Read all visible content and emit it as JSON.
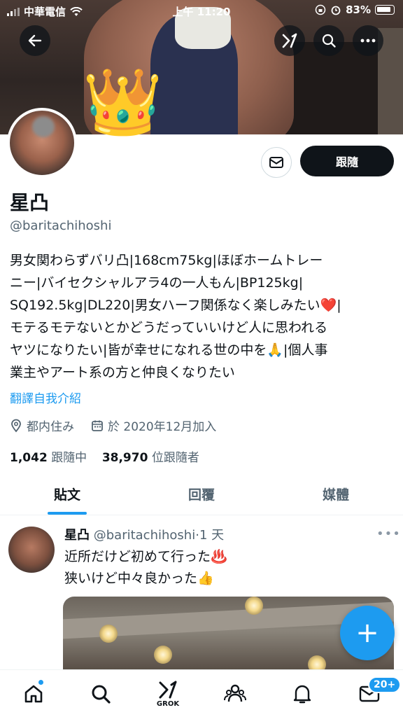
{
  "status_bar": {
    "carrier": "中華電信",
    "time": "上午 11:20",
    "battery": "83%"
  },
  "header": {
    "back_icon": "arrow-left-icon",
    "grok_icon": "grok-icon",
    "search_icon": "search-icon",
    "more_icon": "more-horizontal-icon"
  },
  "profile": {
    "crown": "👑",
    "follow_label": "跟隨",
    "name": "星凸",
    "handle": "@baritachihoshi",
    "bio_lines": [
      "男女関わらずバリ凸|168cm75kg|ほぼホームトレー",
      "ニー|バイセクシャルアラ4の一人もん|BP125kg|",
      "SQ192.5kg|DL220|男女ハーフ関係なく楽しみたい❤️|",
      "モテるモテないとかどうだっていいけど人に思われる",
      "ヤツになりたい|皆が幸せになれる世の中を🙏|個人事",
      "業主やアート系の方と仲良くなりたい"
    ],
    "translate_label": "翻譯自我介紹",
    "location": "都内住み",
    "joined": "於 2020年12月加入",
    "following_count": "1,042",
    "following_label": "跟隨中",
    "followers_count": "38,970",
    "followers_label": "位跟隨者"
  },
  "tabs": [
    {
      "label": "貼文",
      "active": true
    },
    {
      "label": "回覆",
      "active": false
    },
    {
      "label": "媒體",
      "active": false
    }
  ],
  "post": {
    "name": "星凸",
    "handle": "@baritachihoshi",
    "dot": "·",
    "time": "1 天",
    "more": "•••",
    "lines": [
      "近所だけど初めて行った♨️",
      "狭いけど中々良かった👍"
    ]
  },
  "fab": {
    "label": "+"
  },
  "bottom_nav": {
    "grok_label": "GROK",
    "notification_badge": "20+"
  },
  "colors": {
    "accent": "#1d9bf0",
    "text": "#0f1419",
    "muted": "#536471"
  }
}
